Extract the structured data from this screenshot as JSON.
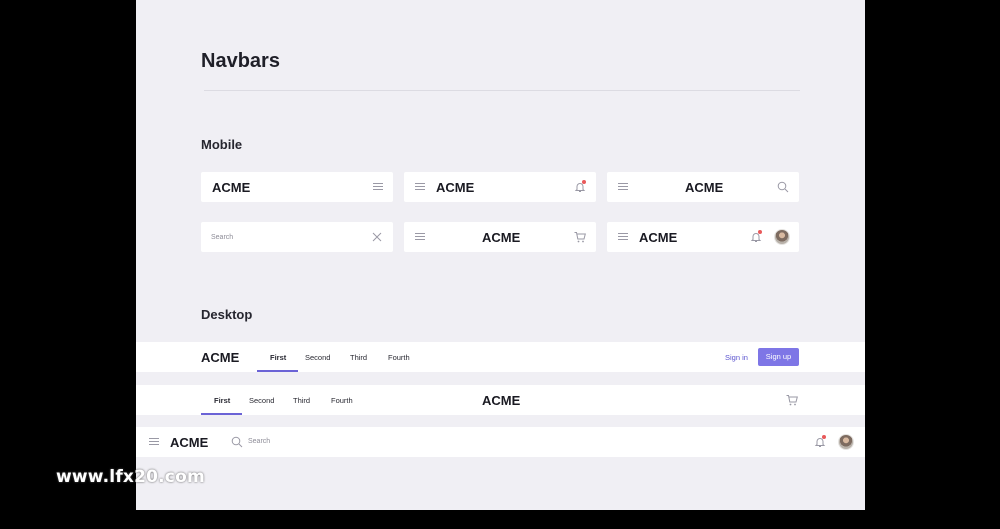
{
  "page": {
    "title": "Navbars"
  },
  "sections": {
    "mobile": "Mobile",
    "desktop": "Desktop"
  },
  "brand": "ACME",
  "mobile": {
    "search_placeholder": "Search"
  },
  "desktop": {
    "links": [
      "First",
      "Second",
      "Third",
      "Fourth"
    ],
    "sign_in": "Sign in",
    "sign_up": "Sign up",
    "search_placeholder": "Search"
  },
  "watermark": "www.lfx20.com",
  "colors": {
    "accent": "#7e76e6",
    "background": "#f0eff4",
    "notification": "#e8595a"
  },
  "icons": [
    "menu-icon",
    "bell-icon",
    "search-icon",
    "close-icon",
    "cart-icon"
  ]
}
